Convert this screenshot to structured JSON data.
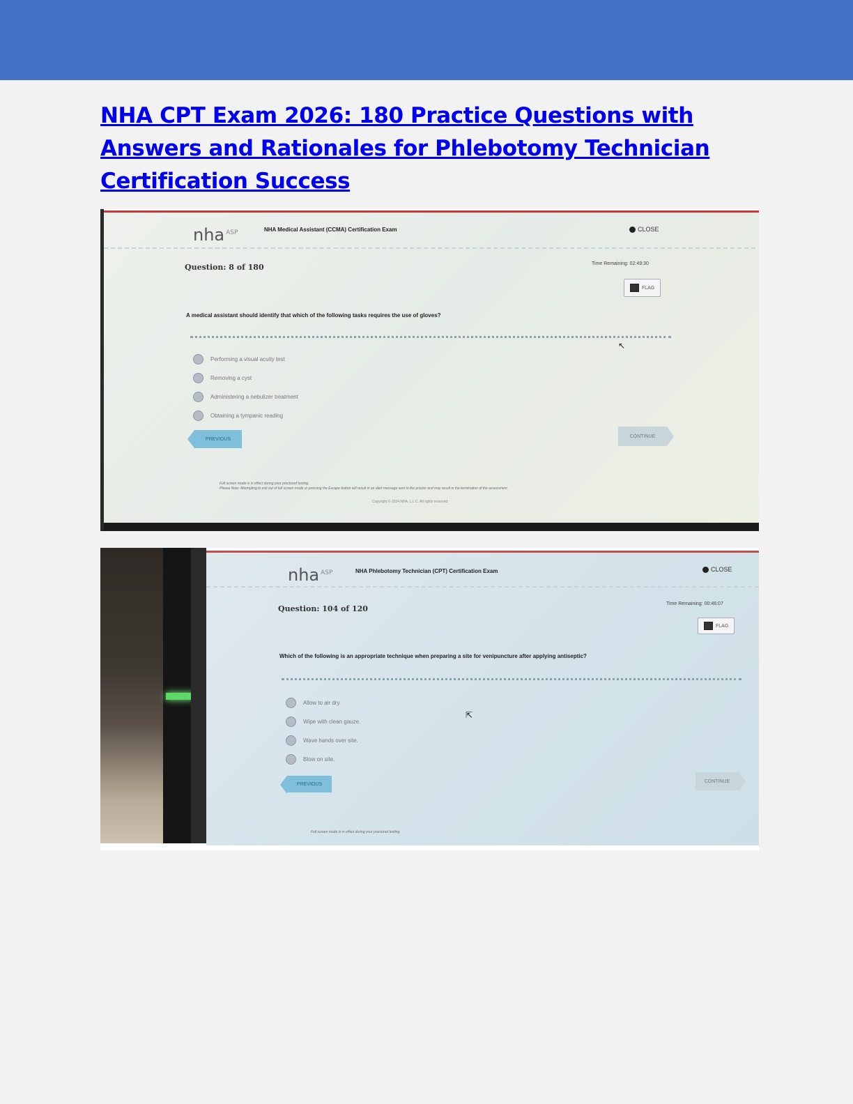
{
  "document": {
    "title": "NHA CPT Exam 2026: 180 Practice Questions with Answers and Rationales for Phlebotomy Technician Certification Success",
    "header_color": "#4472c4",
    "link_color": "#0000ee"
  },
  "photo1": {
    "logo": "nha",
    "logo_sup": "ASP",
    "exam_name": "NHA Medical Assistant (CCMA) Certification Exam",
    "close_label": "CLOSE",
    "question_number": "Question: 8 of 180",
    "time_remaining": "Time Remaining: 02:49:30",
    "flag_label": "FLAG",
    "question": "A medical assistant should identify that which of the following tasks requires the use of gloves?",
    "options": [
      "Performing a visual acuity test",
      "Removing a cyst",
      "Administering a nebulizer treatment",
      "Obtaining a tympanic reading"
    ],
    "previous_label": "PREVIOUS",
    "continue_label": "CONTINUE",
    "footer_line1": "Full screen mode is in effect during your proctored testing.",
    "footer_line2": "Please Note: Attempting to exit out of full screen mode or pressing the Escape button will result in an alert message sent to the proctor and may result in the termination of the assessment.",
    "copyright": "Copyright © 2024 NHA, L.L.C. All rights reserved."
  },
  "photo2": {
    "logo": "nha",
    "logo_sup": "ASP",
    "exam_name": "NHA Phlebotomy Technician (CPT) Certification Exam",
    "close_label": "CLOSE",
    "question_number": "Question: 104 of 120",
    "time_remaining": "Time Remaining: 00:46:07",
    "flag_label": "FLAG",
    "question": "Which of the following is an appropriate technique when preparing a site for venipuncture after applying antiseptic?",
    "options": [
      "Allow to air dry.",
      "Wipe with clean gauze.",
      "Wave hands over site.",
      "Blow on site."
    ],
    "previous_label": "PREVIOUS",
    "continue_label": "CONTINUE",
    "footer_line1": "Full screen mode is in effect during your proctored testing."
  }
}
